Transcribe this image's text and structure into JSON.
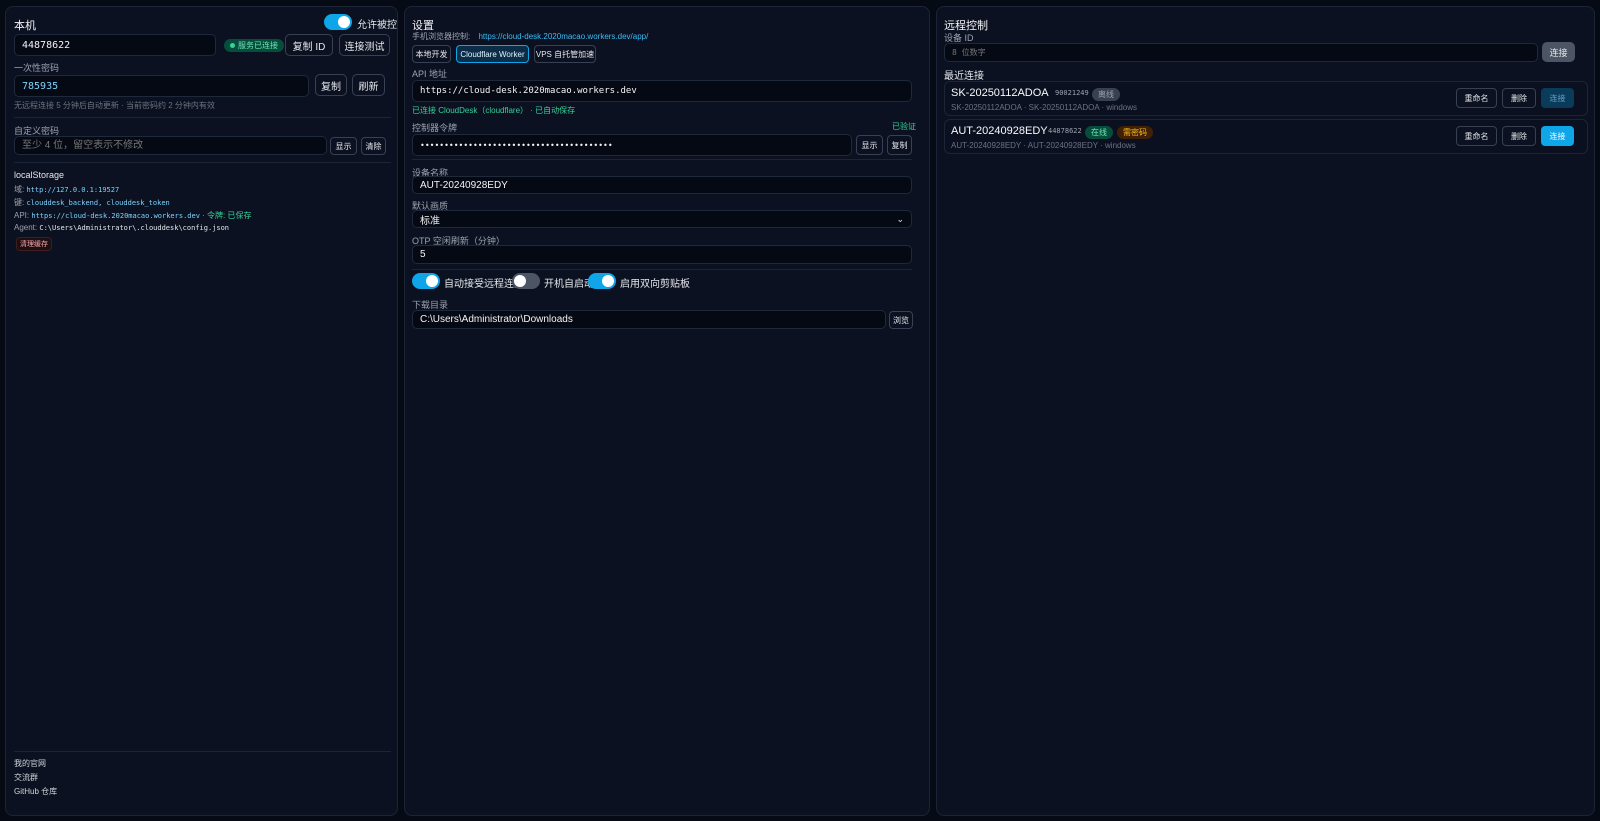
{
  "local": {
    "title": "本机",
    "allow_control_label": "允许被控",
    "allow_control_on": true,
    "device_id": "44878622",
    "service_status": "服务已连接",
    "copy_id_label": "复制 ID",
    "test_conn_label": "连接测试",
    "otp_label": "一次性密码",
    "otp_value": "785935",
    "copy_label": "复制",
    "refresh_label": "刷新",
    "otp_hint": "无远程连接 5 分钟后自动更新 · 当前密码约 2 分钟内有效",
    "custom_pwd_label": "自定义密码",
    "custom_pwd_placeholder": "至少 4 位，留空表示不修改",
    "show_label": "显示",
    "clear_label": "清除",
    "storage_title": "localStorage",
    "domain_key": "域:",
    "domain_val": "http://127.0.0.1:19527",
    "keys_key": "键:",
    "keys_val": "clouddesk_backend, clouddesk_token",
    "api_key": "API:",
    "api_val": "https://cloud-desk.2020macao.workers.dev",
    "token_saved": "· 令牌: 已保存",
    "agent_key": "Agent:",
    "agent_val": "C:\\Users\\Administrator\\.clouddesk\\config.json",
    "clear_cache_label": "清理缓存",
    "footer_links": [
      "我的官网",
      "交流群",
      "GitHub 仓库"
    ]
  },
  "settings": {
    "title": "设置",
    "mobile_ctrl_label": "手机浏览器控制:",
    "mobile_ctrl_url": "https://cloud-desk.2020macao.workers.dev/app/",
    "modes": [
      "本地开发",
      "Cloudflare Worker",
      "VPS 自托管加速"
    ],
    "api_label": "API 地址",
    "api_value": "https://cloud-desk.2020macao.workers.dev",
    "connected_text": "已连接 CloudDesk（cloudflare） · 已自动保存",
    "token_label": "控制器令牌",
    "token_verified": "已验证",
    "token_value": "••••••••••••••••••••••••••••••••••••••••",
    "token_show": "显示",
    "token_copy": "复制",
    "device_name_label": "设备名称",
    "device_name_value": "AUT-20240928EDY",
    "quality_label": "默认画质",
    "quality_value": "标准",
    "otp_idle_label": "OTP 空闲刷新（分钟）",
    "otp_idle_value": "5",
    "toggles": [
      {
        "label": "自动接受远程连接",
        "on": true
      },
      {
        "label": "开机自启动",
        "on": false
      },
      {
        "label": "启用双向剪贴板",
        "on": true
      }
    ],
    "download_label": "下载目录",
    "download_value": "C:\\Users\\Administrator\\Downloads",
    "browse_label": "浏览"
  },
  "remote": {
    "title": "远程控制",
    "device_id_label": "设备 ID",
    "device_id_placeholder": "8 位数字",
    "connect_label": "连接",
    "recent_label": "最近连接",
    "devices": [
      {
        "name": "SK-20250112ADOA",
        "id": "90021249",
        "status": "离线",
        "needs_code": "",
        "sub": "SK-20250112ADOA · SK-20250112ADOA · windows",
        "rename": "重命名",
        "delete": "删除",
        "connect": "连接"
      },
      {
        "name": "AUT-20240928EDY",
        "id": "44878622",
        "status": "在线",
        "needs_code": "需密码",
        "sub": "AUT-20240928EDY · AUT-20240928EDY · windows",
        "rename": "重命名",
        "delete": "删除",
        "connect": "连接"
      }
    ]
  },
  "colors": {
    "accent": "#0ea5e9",
    "success": "#34d399",
    "warning": "#f59e0b",
    "background": "#060a14",
    "panel": "#0b1120"
  }
}
